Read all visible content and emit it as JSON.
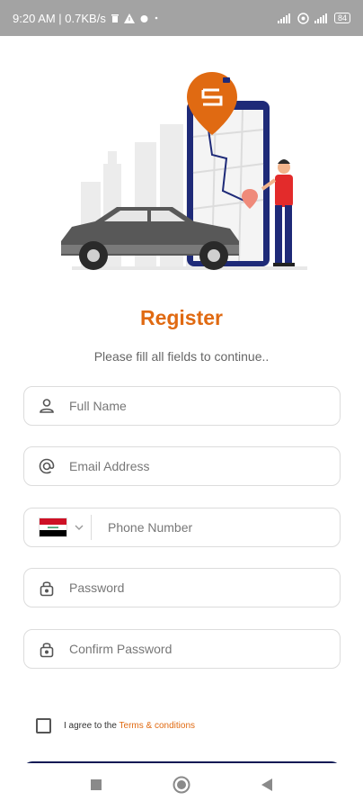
{
  "status_bar": {
    "time_info": "9:20 AM | 0.7KB/s",
    "battery": "84"
  },
  "page": {
    "title": "Register",
    "subtitle": "Please fill all fields to continue.."
  },
  "form": {
    "full_name_placeholder": "Full Name",
    "email_placeholder": "Email Address",
    "phone_placeholder": "Phone Number",
    "password_placeholder": "Password",
    "confirm_password_placeholder": "Confirm Password"
  },
  "terms": {
    "prefix": "I agree to the ",
    "link": "Terms & conditions"
  },
  "colors": {
    "accent": "#e06a12",
    "primary": "#0f1a55"
  },
  "icons": [
    "user-icon",
    "at-icon",
    "iraq-flag-icon",
    "chevron-down-icon",
    "lock-icon",
    "square-icon",
    "circle-icon",
    "triangle-back-icon"
  ]
}
